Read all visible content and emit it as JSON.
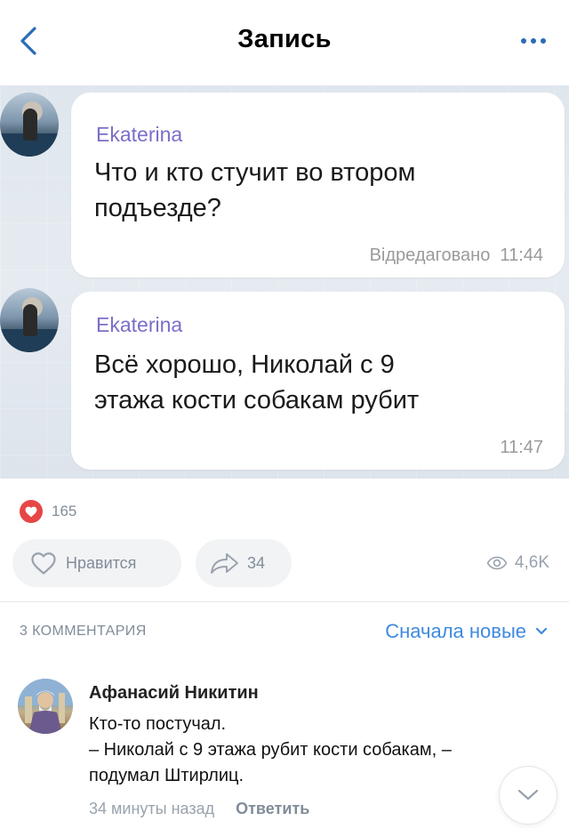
{
  "header": {
    "title": "Запись"
  },
  "chat": {
    "messages": [
      {
        "sender": "Ekaterina",
        "lines": [
          "Что и кто стучит во втором",
          "подъезде?"
        ],
        "meta": "Відредаговано  11:44"
      },
      {
        "sender": "Ekaterina",
        "lines": [
          "Всё хорошо, Николай с 9",
          "этажа кости собакам рубит"
        ],
        "meta": "11:47"
      }
    ]
  },
  "reactions": {
    "count": "165",
    "color": "#e64646"
  },
  "actions": {
    "like_label": "Нравится",
    "share_count": "34",
    "views": "4,6K"
  },
  "comments": {
    "title": "3 КОММЕНТАРИЯ",
    "sort_label": "Сначала новые",
    "items": [
      {
        "author": "Афанасий Никитин",
        "lines": [
          "Кто-то постучал.",
          "– Николай с 9 этажа рубит кости собакам, –",
          "подумал Штирлиц."
        ],
        "time": "34 минуты назад",
        "reply_label": "Ответить"
      }
    ]
  },
  "colors": {
    "accent": "#3f8ae0",
    "secondary_text": "#818c99",
    "sender_name": "#7a6fc9"
  }
}
